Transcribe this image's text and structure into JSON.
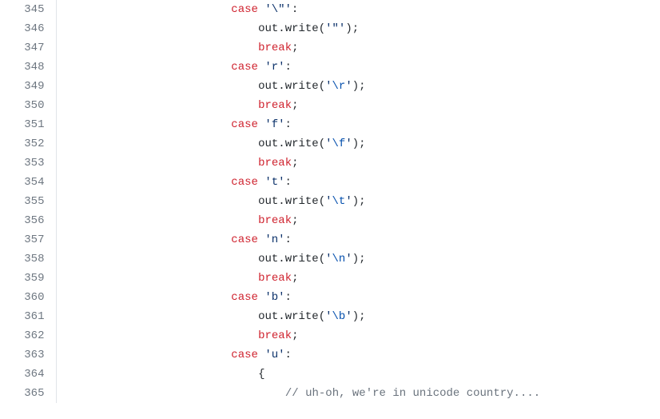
{
  "source": {
    "language": "java-like",
    "context": "switch statement handling escape sequences and unicode"
  },
  "lines": [
    {
      "num": 345,
      "indent": 24,
      "tokens": [
        {
          "t": "k",
          "v": "case"
        },
        {
          "t": "p",
          "v": " "
        },
        {
          "t": "s",
          "v": "'\\\"'"
        },
        {
          "t": "p",
          "v": ":"
        }
      ]
    },
    {
      "num": 346,
      "indent": 28,
      "tokens": [
        {
          "t": "p",
          "v": "out.write("
        },
        {
          "t": "s",
          "v": "'\"'"
        },
        {
          "t": "p",
          "v": ");"
        }
      ]
    },
    {
      "num": 347,
      "indent": 28,
      "tokens": [
        {
          "t": "k",
          "v": "break"
        },
        {
          "t": "p",
          "v": ";"
        }
      ]
    },
    {
      "num": 348,
      "indent": 24,
      "tokens": [
        {
          "t": "k",
          "v": "case"
        },
        {
          "t": "p",
          "v": " "
        },
        {
          "t": "s",
          "v": "'r'"
        },
        {
          "t": "p",
          "v": ":"
        }
      ]
    },
    {
      "num": 349,
      "indent": 28,
      "tokens": [
        {
          "t": "p",
          "v": "out.write("
        },
        {
          "t": "s",
          "v": "'"
        },
        {
          "t": "esc",
          "v": "\\r"
        },
        {
          "t": "s",
          "v": "'"
        },
        {
          "t": "p",
          "v": ");"
        }
      ]
    },
    {
      "num": 350,
      "indent": 28,
      "tokens": [
        {
          "t": "k",
          "v": "break"
        },
        {
          "t": "p",
          "v": ";"
        }
      ]
    },
    {
      "num": 351,
      "indent": 24,
      "tokens": [
        {
          "t": "k",
          "v": "case"
        },
        {
          "t": "p",
          "v": " "
        },
        {
          "t": "s",
          "v": "'f'"
        },
        {
          "t": "p",
          "v": ":"
        }
      ]
    },
    {
      "num": 352,
      "indent": 28,
      "tokens": [
        {
          "t": "p",
          "v": "out.write("
        },
        {
          "t": "s",
          "v": "'"
        },
        {
          "t": "esc",
          "v": "\\f"
        },
        {
          "t": "s",
          "v": "'"
        },
        {
          "t": "p",
          "v": ");"
        }
      ]
    },
    {
      "num": 353,
      "indent": 28,
      "tokens": [
        {
          "t": "k",
          "v": "break"
        },
        {
          "t": "p",
          "v": ";"
        }
      ]
    },
    {
      "num": 354,
      "indent": 24,
      "tokens": [
        {
          "t": "k",
          "v": "case"
        },
        {
          "t": "p",
          "v": " "
        },
        {
          "t": "s",
          "v": "'t'"
        },
        {
          "t": "p",
          "v": ":"
        }
      ]
    },
    {
      "num": 355,
      "indent": 28,
      "tokens": [
        {
          "t": "p",
          "v": "out.write("
        },
        {
          "t": "s",
          "v": "'"
        },
        {
          "t": "esc",
          "v": "\\t"
        },
        {
          "t": "s",
          "v": "'"
        },
        {
          "t": "p",
          "v": ");"
        }
      ]
    },
    {
      "num": 356,
      "indent": 28,
      "tokens": [
        {
          "t": "k",
          "v": "break"
        },
        {
          "t": "p",
          "v": ";"
        }
      ]
    },
    {
      "num": 357,
      "indent": 24,
      "tokens": [
        {
          "t": "k",
          "v": "case"
        },
        {
          "t": "p",
          "v": " "
        },
        {
          "t": "s",
          "v": "'n'"
        },
        {
          "t": "p",
          "v": ":"
        }
      ]
    },
    {
      "num": 358,
      "indent": 28,
      "tokens": [
        {
          "t": "p",
          "v": "out.write("
        },
        {
          "t": "s",
          "v": "'"
        },
        {
          "t": "esc",
          "v": "\\n"
        },
        {
          "t": "s",
          "v": "'"
        },
        {
          "t": "p",
          "v": ");"
        }
      ]
    },
    {
      "num": 359,
      "indent": 28,
      "tokens": [
        {
          "t": "k",
          "v": "break"
        },
        {
          "t": "p",
          "v": ";"
        }
      ]
    },
    {
      "num": 360,
      "indent": 24,
      "tokens": [
        {
          "t": "k",
          "v": "case"
        },
        {
          "t": "p",
          "v": " "
        },
        {
          "t": "s",
          "v": "'b'"
        },
        {
          "t": "p",
          "v": ":"
        }
      ]
    },
    {
      "num": 361,
      "indent": 28,
      "tokens": [
        {
          "t": "p",
          "v": "out.write("
        },
        {
          "t": "s",
          "v": "'"
        },
        {
          "t": "esc",
          "v": "\\b"
        },
        {
          "t": "s",
          "v": "'"
        },
        {
          "t": "p",
          "v": ");"
        }
      ]
    },
    {
      "num": 362,
      "indent": 28,
      "tokens": [
        {
          "t": "k",
          "v": "break"
        },
        {
          "t": "p",
          "v": ";"
        }
      ]
    },
    {
      "num": 363,
      "indent": 24,
      "tokens": [
        {
          "t": "k",
          "v": "case"
        },
        {
          "t": "p",
          "v": " "
        },
        {
          "t": "s",
          "v": "'u'"
        },
        {
          "t": "p",
          "v": ":"
        }
      ]
    },
    {
      "num": 364,
      "indent": 28,
      "tokens": [
        {
          "t": "p",
          "v": "{"
        }
      ]
    },
    {
      "num": 365,
      "indent": 32,
      "tokens": [
        {
          "t": "c",
          "v": "// uh-oh, we're in unicode country...."
        }
      ]
    }
  ]
}
